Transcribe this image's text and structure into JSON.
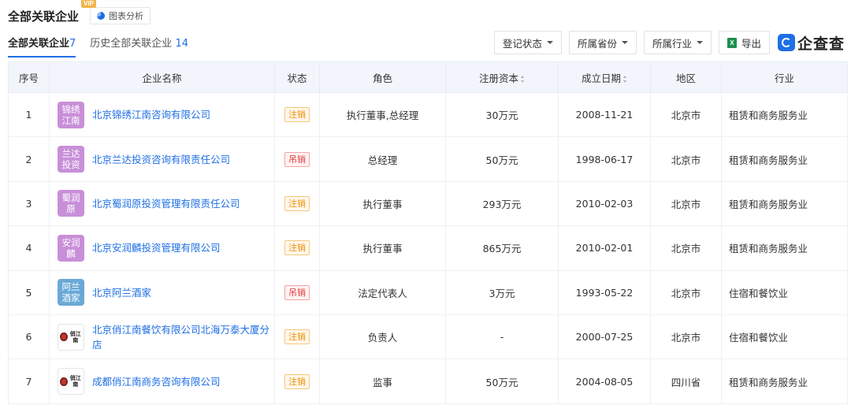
{
  "header": {
    "title": "全部关联企业",
    "vip": "VIP",
    "chart_btn": "图表分析"
  },
  "tabs": [
    {
      "label": "全部关联企业",
      "count": "7",
      "active": true
    },
    {
      "label": "历史全部关联企业",
      "count": "14",
      "active": false
    }
  ],
  "toolbar": {
    "filters": [
      "登记状态",
      "所属省份",
      "所属行业"
    ],
    "export_label": "导出",
    "export_icon": "X",
    "brand": "企查查"
  },
  "table": {
    "columns": [
      "序号",
      "企业名称",
      "状态",
      "角色",
      "注册资本",
      "成立日期",
      "地区",
      "行业"
    ],
    "rows": [
      {
        "no": "1",
        "logo_text": "锦绣江南",
        "logo_color": "#c88fd8",
        "logo_type": "text",
        "name": "北京锦绣江南咨询有限公司",
        "status": "注销",
        "status_type": "orange",
        "role": "执行董事,总经理",
        "capital": "30万元",
        "date": "2008-11-21",
        "region": "北京市",
        "industry": "租赁和商务服务业"
      },
      {
        "no": "2",
        "logo_text": "兰达投资",
        "logo_color": "#c88fd8",
        "logo_type": "text",
        "name": "北京兰达投资咨询有限责任公司",
        "status": "吊销",
        "status_type": "red",
        "role": "总经理",
        "capital": "50万元",
        "date": "1998-06-17",
        "region": "北京市",
        "industry": "租赁和商务服务业"
      },
      {
        "no": "3",
        "logo_text": "蜀润原",
        "logo_color": "#c88fd8",
        "logo_type": "text",
        "name": "北京蜀润原投资管理有限责任公司",
        "status": "注销",
        "status_type": "orange",
        "role": "执行董事",
        "capital": "293万元",
        "date": "2010-02-03",
        "region": "北京市",
        "industry": "租赁和商务服务业"
      },
      {
        "no": "4",
        "logo_text": "安润麟",
        "logo_color": "#c88fd8",
        "logo_type": "text",
        "name": "北京安润麟投资管理有限公司",
        "status": "注销",
        "status_type": "orange",
        "role": "执行董事",
        "capital": "865万元",
        "date": "2010-02-01",
        "region": "北京市",
        "industry": "租赁和商务服务业"
      },
      {
        "no": "5",
        "logo_text": "阿兰酒家",
        "logo_color": "#6aa9d6",
        "logo_type": "text",
        "name": "北京阿兰酒家",
        "status": "吊销",
        "status_type": "red",
        "role": "法定代表人",
        "capital": "3万元",
        "date": "1993-05-22",
        "region": "北京市",
        "industry": "住宿和餐饮业"
      },
      {
        "no": "6",
        "logo_text": "俏江南",
        "logo_color": "#ffffff",
        "logo_type": "image",
        "name": "北京俏江南餐饮有限公司北海万泰大厦分店",
        "status": "注销",
        "status_type": "orange",
        "role": "负责人",
        "capital": "-",
        "date": "2000-07-25",
        "region": "北京市",
        "industry": "住宿和餐饮业"
      },
      {
        "no": "7",
        "logo_text": "俏江南",
        "logo_color": "#ffffff",
        "logo_type": "image",
        "name": "成都俏江南商务咨询有限公司",
        "status": "注销",
        "status_type": "orange",
        "role": "监事",
        "capital": "50万元",
        "date": "2004-08-05",
        "region": "四川省",
        "industry": "租赁和商务服务业"
      }
    ]
  }
}
